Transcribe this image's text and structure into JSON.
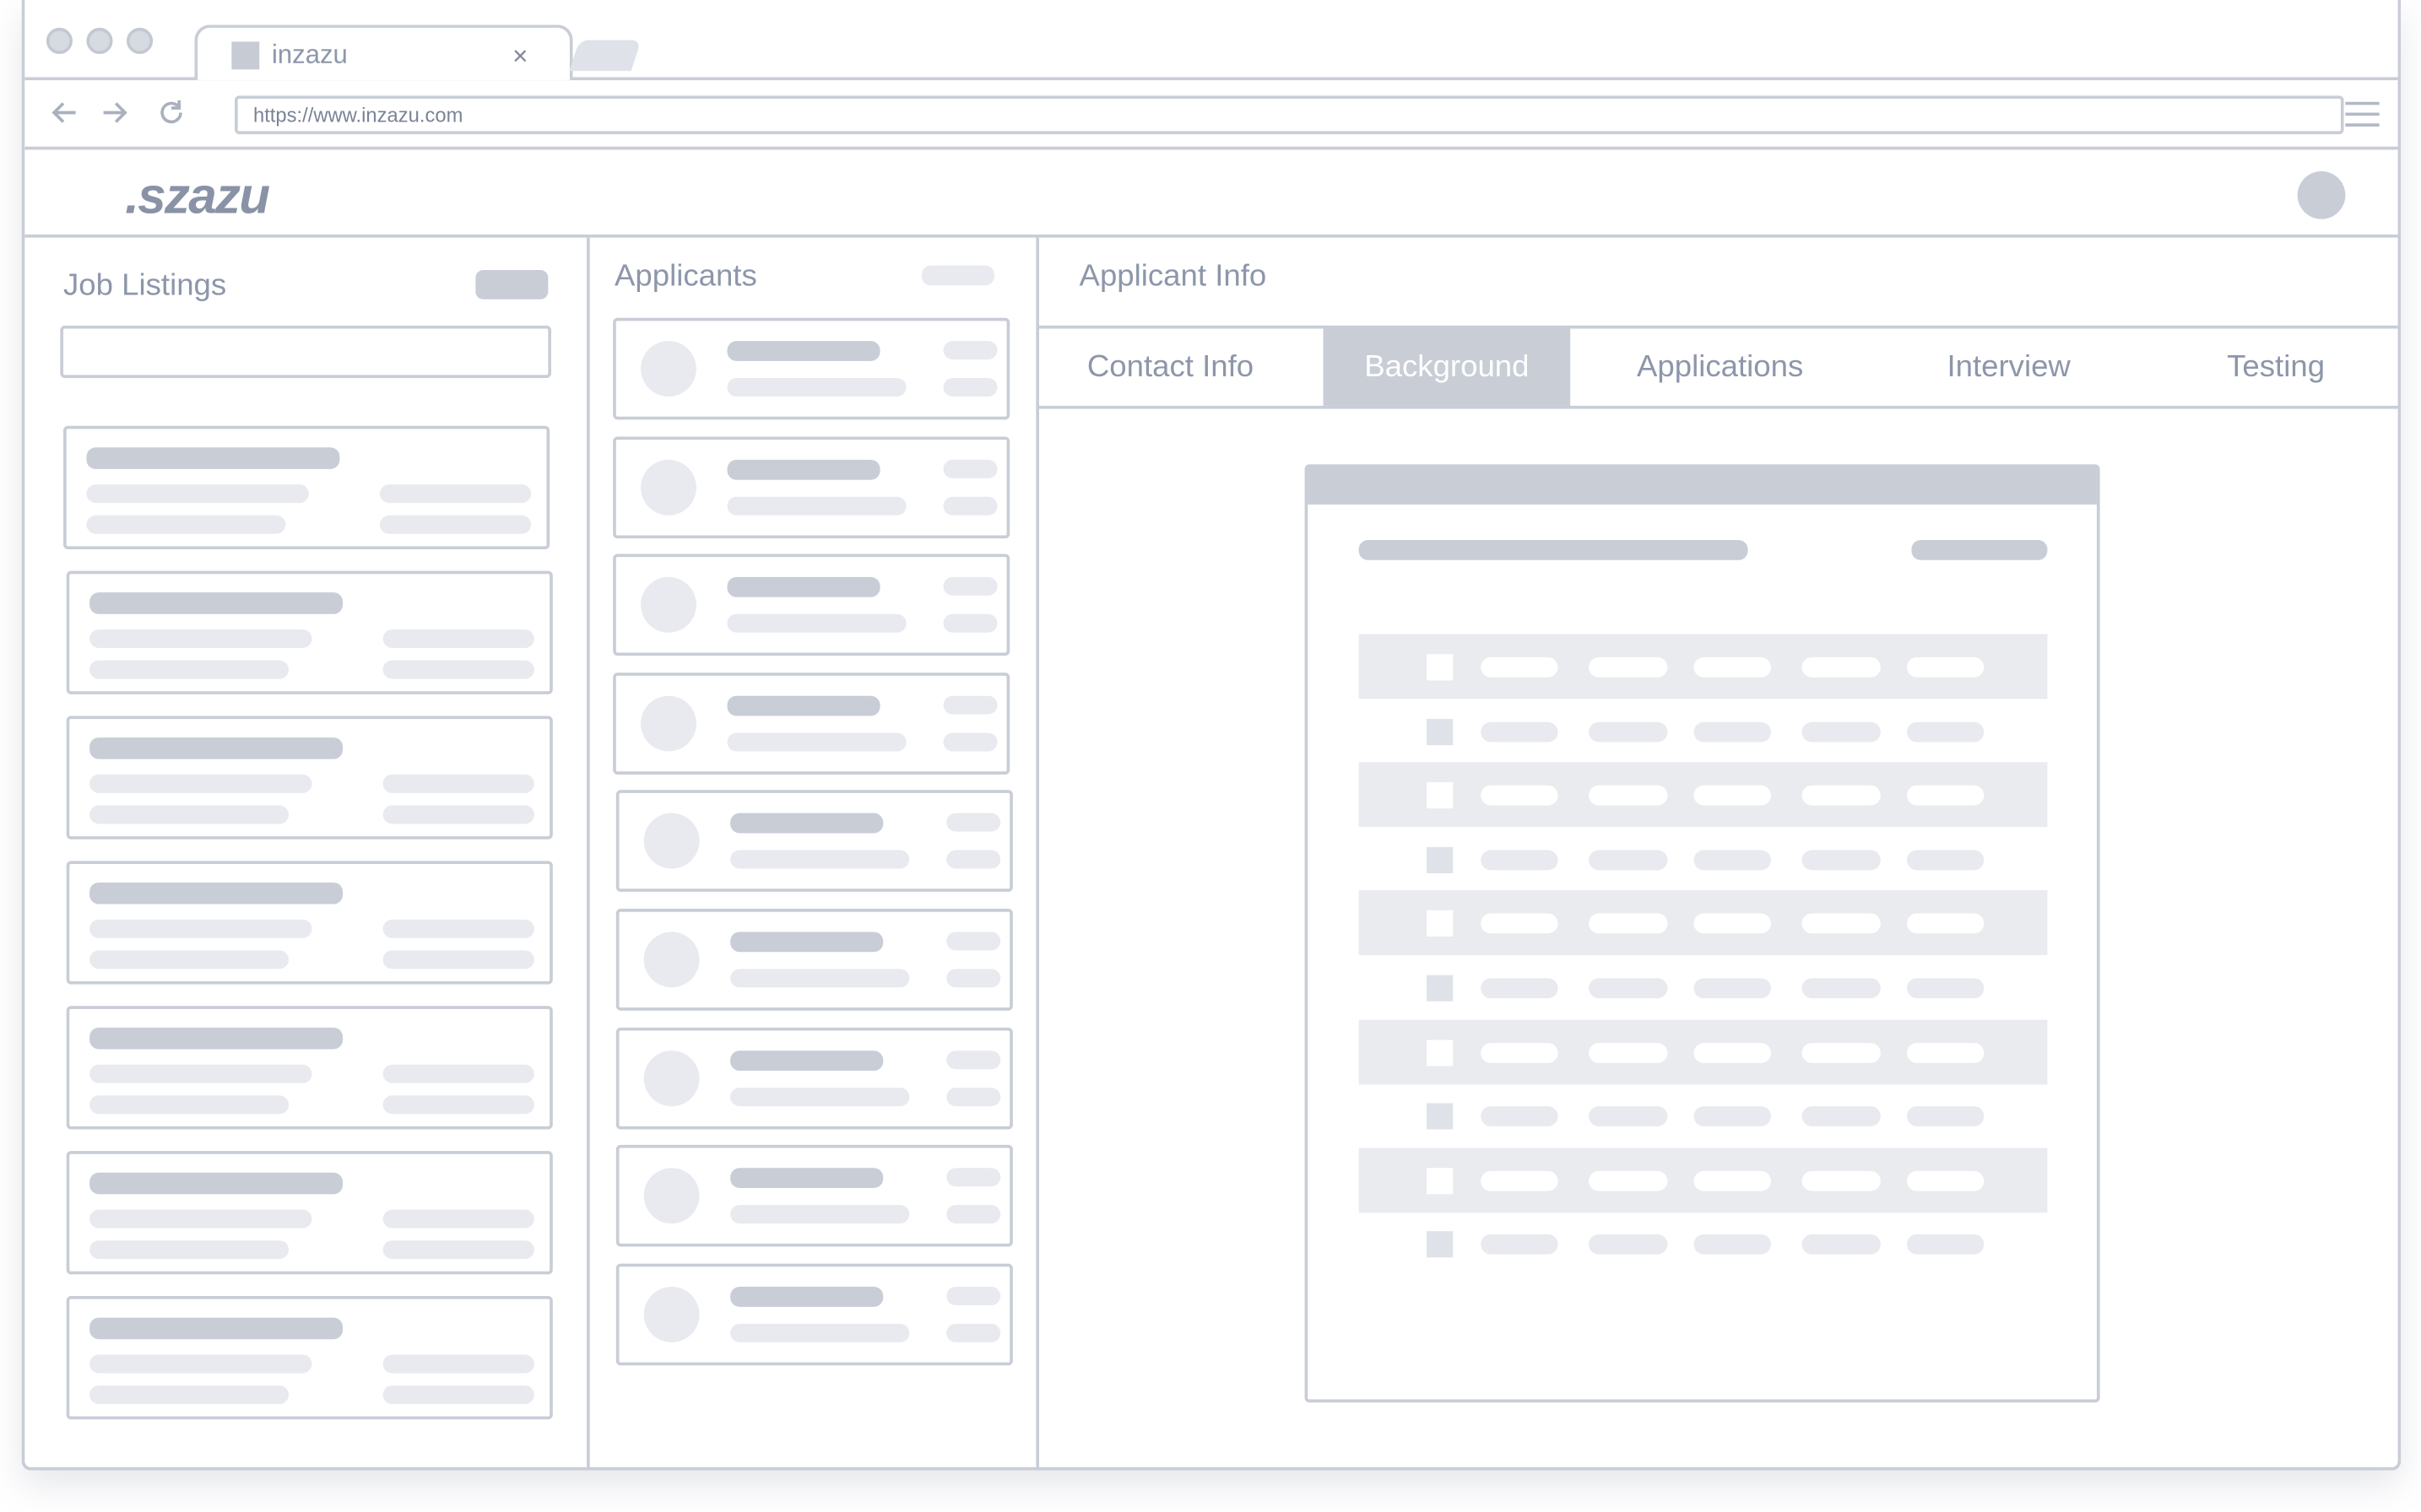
{
  "browser": {
    "tab_title": "inzazu",
    "tab_close": "×",
    "url": "https://www.inzazu.com",
    "icons": {
      "back": "arrow-left-icon",
      "forward": "arrow-right-icon",
      "reload": "reload-icon",
      "menu": "hamburger-menu-icon"
    }
  },
  "app": {
    "logo": ".szazu"
  },
  "job_listings": {
    "title": "Job Listings",
    "card_count": 7
  },
  "applicants": {
    "title": "Applicants",
    "card_count": 9
  },
  "applicant_info": {
    "title": "Applicant Info",
    "tabs": [
      {
        "label": "Contact Info",
        "active": false
      },
      {
        "label": "Background",
        "active": true
      },
      {
        "label": "Applications",
        "active": false
      },
      {
        "label": "Interview",
        "active": false
      },
      {
        "label": "Testing",
        "active": false
      }
    ],
    "document": {
      "row_count": 10,
      "columns_per_row": 5
    }
  },
  "colors": {
    "border": "#c8cdd6",
    "placeholder_dark": "#c8cdd6",
    "placeholder_light": "#e8eaef",
    "band": "#e9ebef",
    "text": "#8d96aa"
  }
}
